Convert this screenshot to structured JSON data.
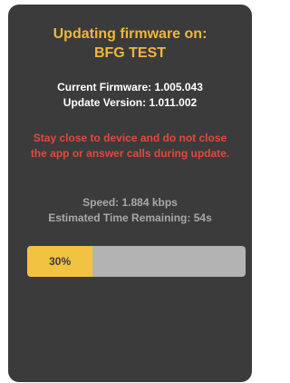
{
  "header": {
    "title_line1": "Updating firmware on:",
    "title_line2": "BFG TEST"
  },
  "firmware": {
    "current": "Current Firmware: 1.005.043",
    "update": "Update Version: 1.011.002"
  },
  "warning": "Stay close to device and do not close the app or answer calls during update.",
  "status": {
    "speed": "Speed: 1.884 kbps",
    "remaining": "Estimated Time Remaining: 54s"
  },
  "progress": {
    "label": "30%",
    "fraction": 0.3
  },
  "colors": {
    "panel": "#3b3b3b",
    "accent": "#f0b63d",
    "warning": "#e2483d",
    "muted": "#a8a8a8",
    "track": "#b3b3b3",
    "fill": "#f2c340"
  }
}
